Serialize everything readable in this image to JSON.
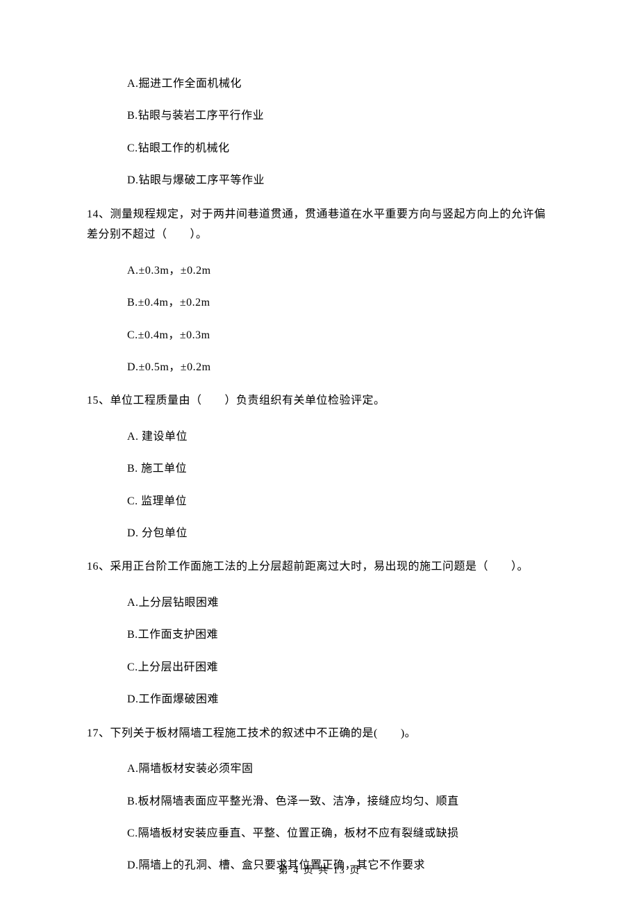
{
  "prev_question_options": {
    "A": "A.掘进工作全面机械化",
    "B": "B.钻眼与装岩工序平行作业",
    "C": "C.钻眼工作的机械化",
    "D": "D.钻眼与爆破工序平等作业"
  },
  "q14": {
    "text": "14、测量规程规定，对于两井间巷道贯通，贯通巷道在水平重要方向与竖起方向上的允许偏差分别不超过（　　）。",
    "options": {
      "A": "A.±0.3m，±0.2m",
      "B": "B.±0.4m，±0.2m",
      "C": "C.±0.4m，±0.3m",
      "D": "D.±0.5m，±0.2m"
    }
  },
  "q15": {
    "text": "15、单位工程质量由（　　）负责组织有关单位检验评定。",
    "options": {
      "A": "A. 建设单位",
      "B": "B. 施工单位",
      "C": "C. 监理单位",
      "D": "D. 分包单位"
    }
  },
  "q16": {
    "text": "16、采用正台阶工作面施工法的上分层超前距离过大时，易出现的施工问题是（　　）。",
    "options": {
      "A": "A.上分层钻眼困难",
      "B": "B.工作面支护困难",
      "C": "C.上分层出矸困难",
      "D": "D.工作面爆破困难"
    }
  },
  "q17": {
    "text": "17、下列关于板材隔墙工程施工技术的叙述中不正确的是(　　)。",
    "options": {
      "A": "A.隔墙板材安装必须牢固",
      "B": "B.板材隔墙表面应平整光滑、色泽一致、洁净，接缝应均匀、顺直",
      "C": "C.隔墙板材安装应垂直、平整、位置正确，板材不应有裂缝或缺损",
      "D": "D.隔墙上的孔洞、槽、盒只要求其位置正确，其它不作要求"
    }
  },
  "footer": "第 4 页 共 13 页"
}
